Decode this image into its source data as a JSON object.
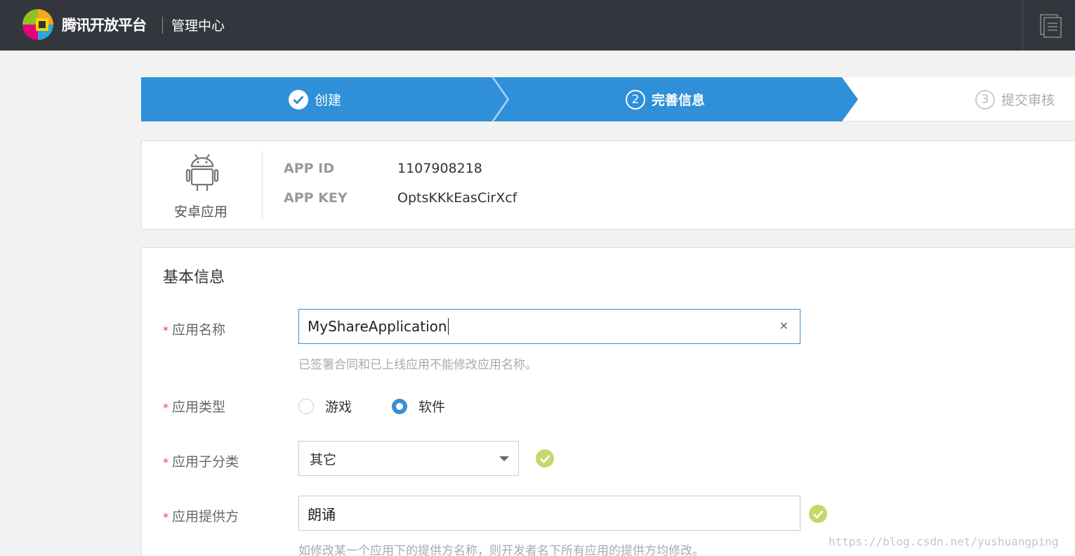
{
  "header": {
    "brand": "腾讯开放平台",
    "center_title": "管理中心",
    "icons": {
      "logo": "tencent-open-logo",
      "menu": "document-list-icon"
    }
  },
  "steps": [
    {
      "label": "创建",
      "state": "done",
      "marker": "check"
    },
    {
      "label": "完善信息",
      "state": "current",
      "marker": "2"
    },
    {
      "label": "提交审核",
      "state": "pending",
      "marker": "3"
    }
  ],
  "app": {
    "platform_label": "安卓应用",
    "app_id_label": "APP ID",
    "app_id": "1107908218",
    "app_key_label": "APP KEY",
    "app_key": "OptsKKkEasCirXcf"
  },
  "form": {
    "section_title": "基本信息",
    "required_mark": "*",
    "app_name": {
      "label": "应用名称",
      "value": "MyShareApplication",
      "clear": "×",
      "hint": "已签署合同和已上线应用不能修改应用名称。"
    },
    "app_type": {
      "label": "应用类型",
      "options": [
        {
          "label": "游戏",
          "checked": false
        },
        {
          "label": "软件",
          "checked": true
        }
      ]
    },
    "sub_category": {
      "label": "应用子分类",
      "value": "其它"
    },
    "provider": {
      "label": "应用提供方",
      "value": "朗诵",
      "hint": "如修改某一个应用下的提供方名称，则开发者名下所有应用的提供方均修改。"
    }
  },
  "watermark": "https://blog.csdn.net/yushuangping",
  "colors": {
    "topbar": "#33373d",
    "step_active": "#2f8fd8",
    "accent": "#3a8ed3",
    "valid": "#c5d86d",
    "required": "#e8473b"
  }
}
